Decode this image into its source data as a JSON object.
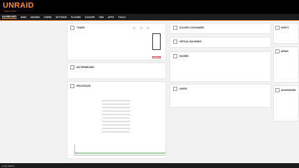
{
  "brand": {
    "name": "UNRAID",
    "subtitle": "Tower 6.12.4"
  },
  "nav": [
    "DASHBOARD",
    "MAIN",
    "SHARES",
    "USERS",
    "SETTINGS",
    "PLUGINS",
    "DOCKER",
    "VMS",
    "APPS",
    "TOOLS"
  ],
  "tower": {
    "title": "TOWER"
  },
  "motherboard": {
    "title": "MOTHERBOARD"
  },
  "processor": {
    "title": "PROCESSOR"
  },
  "docker": {
    "title": "DOCKER CONTAINERS"
  },
  "vms": {
    "title": "VIRTUAL MACHINES"
  },
  "shares": {
    "title": "SHARES"
  },
  "users": {
    "title": "USERS"
  },
  "parity": {
    "title": "PARITY"
  },
  "array": {
    "title": "ARRAY"
  },
  "unassigned": {
    "title": "UNASSIGNED"
  },
  "status": {
    "text": "Array Started"
  }
}
